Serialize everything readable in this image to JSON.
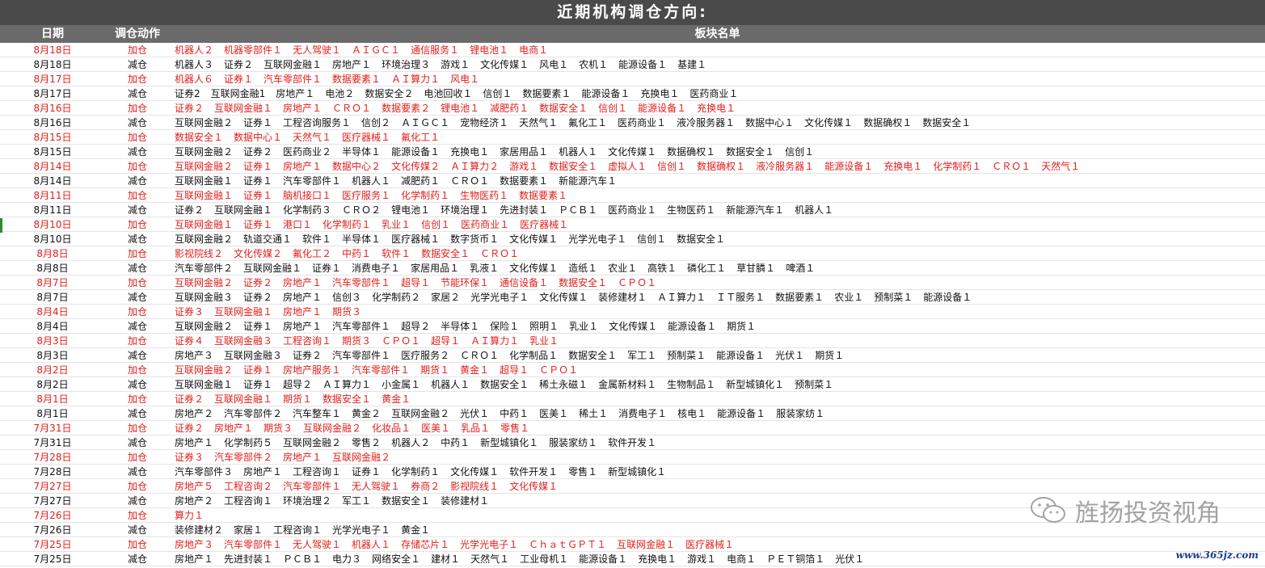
{
  "title": "近期机构调仓方向:",
  "headers": {
    "date": "日期",
    "action": "调仓动作",
    "sectors": "板块名单"
  },
  "colors": {
    "add": "#e0201c",
    "reduce": "#111111",
    "title_bg": "#4a4a4a",
    "header_bg": "#6a6a6a"
  },
  "rows": [
    {
      "date": "8月18日",
      "action": "加仓",
      "type": "add",
      "sectors": [
        "机器人２",
        "机器零部件１",
        "无人驾驶１",
        "ＡＩＧＣ１",
        "通信服务１",
        "锂电池１",
        "电商１"
      ]
    },
    {
      "date": "8月18日",
      "action": "减仓",
      "type": "reduce",
      "sectors": [
        "机器人３",
        "证券２",
        "互联网金融１",
        "房地产１",
        "环境治理３",
        "游戏１",
        "文化传媒１",
        "风电１",
        "农机１",
        "能源设备１",
        "基建１"
      ]
    },
    {
      "date": "8月17日",
      "action": "加仓",
      "type": "add",
      "sectors": [
        "机器人６",
        "证券１",
        "汽车零部件１",
        "数据要素１",
        "ＡＩ算力１",
        "风电１"
      ]
    },
    {
      "date": "8月17日",
      "action": "减仓",
      "type": "reduce",
      "sectors": [
        "证券2",
        "互联网金融1",
        "房地产１",
        "电池２",
        "数据安全２",
        "电池回收１",
        "信创１",
        "数据要素１",
        "能源设备１",
        "充换电１",
        "医药商业１"
      ]
    },
    {
      "date": "8月16日",
      "action": "加仓",
      "type": "add",
      "sectors": [
        "证券２",
        "互联网金融１",
        "房地产１",
        "ＣＲＯ１",
        "数据要素２",
        "锂电池１",
        "减肥药１",
        "数据安全１",
        "信创１",
        "能源设备１",
        "充换电１"
      ]
    },
    {
      "date": "8月16日",
      "action": "减仓",
      "type": "reduce",
      "sectors": [
        "互联网金融２",
        "证券１",
        "工程咨询服务１",
        "信创２",
        "ＡＩＧＣ１",
        "宠物经济１",
        "天然气１",
        "氟化工１",
        "医药商业１",
        "液冷服务器１",
        "数据中心１",
        "文化传媒１",
        "数据确权１",
        "数据安全１"
      ]
    },
    {
      "date": "8月15日",
      "action": "加仓",
      "type": "add",
      "sectors": [
        "数据安全１",
        "数据中心１",
        "天然气１",
        "医疗器械１",
        "氟化工１"
      ]
    },
    {
      "date": "8月15日",
      "action": "减仓",
      "type": "reduce",
      "sectors": [
        "互联网金融２",
        "证券２",
        "医药商业２",
        "半导体１",
        "能源设备１",
        "充换电１",
        "家居用品１",
        "机器人１",
        "文化传媒１",
        "数据确权１",
        "数据安全１",
        "信创１"
      ]
    },
    {
      "date": "8月14日",
      "action": "加仓",
      "type": "add",
      "sectors": [
        "互联网金融２",
        "证券１",
        "房地产１",
        "数据中心２",
        "文化传媒２",
        "ＡＩ算力２",
        "游戏１",
        "数据安全１",
        "虚拟人１",
        "信创１",
        "数据确权１",
        "液冷服务器１",
        "能源设备１",
        "充换电１",
        "化学制药１",
        "ＣＲＯ１",
        "天然气１"
      ]
    },
    {
      "date": "8月14日",
      "action": "减仓",
      "type": "reduce",
      "sectors": [
        "互联网金融１",
        "证券１",
        "汽车零部件１",
        "机器人１",
        "减肥药１",
        "ＣＲＯ１",
        "数据要素１",
        "新能源汽车１"
      ]
    },
    {
      "date": "8月11日",
      "action": "加仓",
      "type": "add",
      "sectors": [
        "互联网金融１",
        "证券１",
        "脑机接口１",
        "医疗服务１",
        "化学制药１",
        "生物医药１",
        "数据要素１"
      ]
    },
    {
      "date": "8月11日",
      "action": "减仓",
      "type": "reduce",
      "sectors": [
        "证券２",
        "互联网金融１",
        "化学制药３",
        "ＣＲＯ２",
        "锂电池１",
        "环境治理１",
        "先进封装１",
        "ＰＣＢ１",
        "医药商业１",
        "生物医药１",
        "新能源汽车１",
        "机器人１"
      ]
    },
    {
      "date": "8月10日",
      "action": "加仓",
      "type": "add",
      "sectors": [
        "互联网金融１",
        "证券１",
        "港口１",
        "化学制药１",
        "乳业１",
        "信创１",
        "医药商业１",
        "医疗器械１"
      ]
    },
    {
      "date": "8月10日",
      "action": "减仓",
      "type": "reduce",
      "sectors": [
        "互联网金融２",
        "轨道交通１",
        "软件１",
        "半导体１",
        "医疗器械１",
        "数字货币１",
        "文化传媒１",
        "光学光电子１",
        "信创１",
        "数据安全１"
      ]
    },
    {
      "date": "8月8日",
      "action": "加仓",
      "type": "add",
      "sectors": [
        "影视院线２",
        "文化传媒２",
        "氟化工２",
        "中药１",
        "软件１",
        "数据安全１",
        "ＣＲＯ１"
      ]
    },
    {
      "date": "8月8日",
      "action": "减仓",
      "type": "reduce",
      "sectors": [
        "汽车零部件２",
        "互联网金融１",
        "证券１",
        "消费电子１",
        "家居用品１",
        "乳液１",
        "文化传媒１",
        "造纸１",
        "农业１",
        "高铁１",
        "磷化工１",
        "草甘膦１",
        "啤酒１"
      ]
    },
    {
      "date": "8月7日",
      "action": "加仓",
      "type": "add",
      "sectors": [
        "互联网金融２",
        "证券２",
        "房地产１",
        "汽车零部件１",
        "超导１",
        "节能环保１",
        "通信设备１",
        "数据安全１",
        "ＣＰＯ１"
      ]
    },
    {
      "date": "8月7日",
      "action": "减仓",
      "type": "reduce",
      "sectors": [
        "互联网金融３",
        "证券２",
        "房地产１",
        "信创３",
        "化学制药２",
        "家居２",
        "光学光电子１",
        "文化传媒１",
        "装修建材１",
        "ＡＩ算力１",
        "ＩＴ服务１",
        "数据要素１",
        "农业１",
        "预制菜１",
        "能源设备１"
      ]
    },
    {
      "date": "8月4日",
      "action": "加仓",
      "type": "add",
      "sectors": [
        "证券３",
        "互联网金融１",
        "房地产１",
        "期货３"
      ]
    },
    {
      "date": "8月4日",
      "action": "减仓",
      "type": "reduce",
      "sectors": [
        "互联网金融２",
        "证券１",
        "房地产１",
        "汽车零部件１",
        "超导２",
        "半导体１",
        "保险１",
        "照明１",
        "乳业１",
        "文化传媒１",
        "能源设备１",
        "期货１"
      ]
    },
    {
      "date": "8月3日",
      "action": "加仓",
      "type": "add",
      "sectors": [
        "证券４",
        "互联网金融３",
        "工程咨询１",
        "期货３",
        "ＣＰＯ１",
        "超导１",
        "ＡＩ算力１",
        "乳业１"
      ]
    },
    {
      "date": "8月3日",
      "action": "减仓",
      "type": "reduce",
      "sectors": [
        "房地产３",
        "互联网金融３",
        "证券２",
        "汽车零部件１",
        "医疗服务２",
        "ＣＲＯ１",
        "化学制品１",
        "数据安全１",
        "军工１",
        "预制菜１",
        "能源设备１",
        "光伏１",
        "期货１"
      ]
    },
    {
      "date": "8月2日",
      "action": "加仓",
      "type": "add",
      "sectors": [
        "互联网金融２",
        "证券１",
        "房地产服务１",
        "汽车零部件１",
        "期货１",
        "黄金１",
        "超导１",
        "ＣＰＯ１"
      ]
    },
    {
      "date": "8月2日",
      "action": "减仓",
      "type": "reduce",
      "sectors": [
        "互联网金融１",
        "证券１",
        "超导２",
        "ＡＩ算力１",
        "小金属１",
        "机器人１",
        "数据安全１",
        "稀土永磁１",
        "金属新材料１",
        "生物制品１",
        "新型城镇化１",
        "预制菜１"
      ]
    },
    {
      "date": "8月1日",
      "action": "加仓",
      "type": "add",
      "sectors": [
        "证券２",
        "互联网金融１",
        "期货１",
        "数据安全１",
        "黄金１"
      ]
    },
    {
      "date": "8月1日",
      "action": "减仓",
      "type": "reduce",
      "sectors": [
        "房地产２",
        "汽车零部件２",
        "汽车整车１",
        "黄金２",
        "互联网金融２",
        "光伏１",
        "中药１",
        "医美１",
        "稀土１",
        "消费电子１",
        "核电１",
        "能源设备１",
        "服装家纺１"
      ]
    },
    {
      "date": "7月31日",
      "action": "加仓",
      "type": "add",
      "sectors": [
        "证券２",
        "房地产１",
        "期货３",
        "互联网金融２",
        "化妆品１",
        "医美１",
        "乳品１",
        "零售１"
      ]
    },
    {
      "date": "7月31日",
      "action": "减仓",
      "type": "reduce",
      "sectors": [
        "房地产１",
        "化学制药５",
        "互联网金融２",
        "零售２",
        "机器人２",
        "中药１",
        "新型城镇化１",
        "服装家纺１",
        "软件开发１"
      ]
    },
    {
      "date": "7月28日",
      "action": "加仓",
      "type": "add",
      "sectors": [
        "证券３",
        "汽车零部件２",
        "房地产１",
        "互联网金融２"
      ]
    },
    {
      "date": "7月28日",
      "action": "减仓",
      "type": "reduce",
      "sectors": [
        "汽车零部件３",
        "房地产１",
        "工程咨询１",
        "证券１",
        "化学制药１",
        "文化传媒１",
        "软件开发１",
        "零售１",
        "新型城镇化１"
      ]
    },
    {
      "date": "7月27日",
      "action": "加仓",
      "type": "add",
      "sectors": [
        "房地产５",
        "工程咨询２",
        "汽车零部件１",
        "无人驾驶１",
        "券商２",
        "影视院线１",
        "文化传媒１"
      ]
    },
    {
      "date": "7月27日",
      "action": "减仓",
      "type": "reduce",
      "sectors": [
        "房地产２",
        "工程咨询１",
        "环境治理２",
        "军工１",
        "数据安全１",
        "装修建材１"
      ]
    },
    {
      "date": "7月26日",
      "action": "加仓",
      "type": "add",
      "sectors": [
        "算力１"
      ]
    },
    {
      "date": "7月26日",
      "action": "减仓",
      "type": "reduce",
      "sectors": [
        "装修建材２",
        "家居１",
        "工程咨询１",
        "光学光电子１",
        "黄金１"
      ]
    },
    {
      "date": "7月25日",
      "action": "加仓",
      "type": "add",
      "sectors": [
        "房地产３",
        "汽车零部件１",
        "无人驾驶１",
        "机器人１",
        "存储芯片１",
        "光学光电子１",
        "ＣｈａｔＧＰＴ１",
        "互联网金融１",
        "医疗器械１"
      ]
    },
    {
      "date": "7月25日",
      "action": "减仓",
      "type": "reduce",
      "sectors": [
        "房地产１",
        "先进封装１",
        "ＰＣＢ１",
        "电力３",
        "网络安全１",
        "建材１",
        "天然气１",
        "工业母机１",
        "能源设备１",
        "充换电１",
        "游戏１",
        "电商１",
        "ＰＥＴ铜箔１",
        "光伏１"
      ]
    }
  ],
  "watermark": {
    "text": "旌扬投资视角",
    "icon": "wechat-icon"
  },
  "site_url": "www.365jz.com"
}
